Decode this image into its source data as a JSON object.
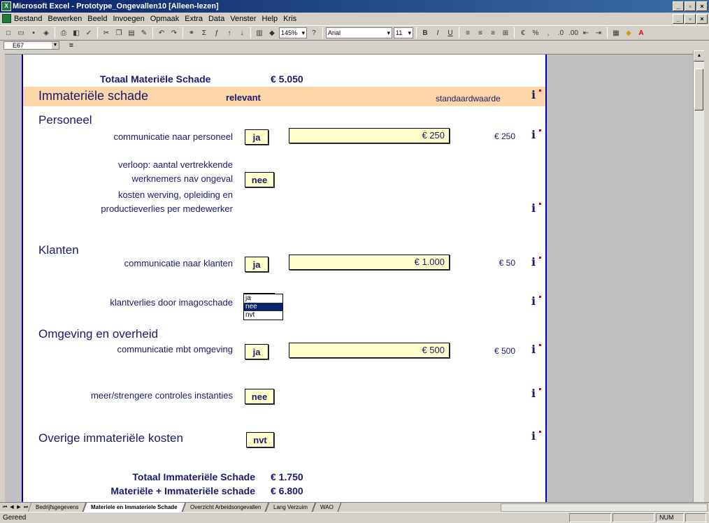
{
  "window": {
    "title": "Microsoft Excel - Prototype_Ongevallen10  [Alleen-lezen]"
  },
  "menu": [
    "Bestand",
    "Bewerken",
    "Beeld",
    "Invoegen",
    "Opmaak",
    "Extra",
    "Data",
    "Venster",
    "Help",
    "Kris"
  ],
  "toolbar": {
    "zoom": "145%",
    "font": "Arial",
    "size": "11"
  },
  "formula": {
    "cell": "E67",
    "eq": "="
  },
  "sheet": {
    "total_materieel_label": "Totaal Materiële Schade",
    "total_materieel_value": "€ 5.050",
    "banner_title": "Immateriële schade",
    "banner_relevant": "relevant",
    "banner_standard": "standaardwaarde",
    "sec_personeel": "Personeel",
    "row1_label": "communicatie naar personeel",
    "row1_sel": "ja",
    "row1_amount": "€ 250",
    "row1_std": "€ 250",
    "row2_label_a": "verloop: aantal vertrekkende",
    "row2_label_b": "werknemers nav ongeval",
    "row2_sel": "nee",
    "row2_label_c": "kosten werving, opleiding en",
    "row2_label_d": "productieverlies per medewerker",
    "sec_klanten": "Klanten",
    "row3_label": "communicatie naar klanten",
    "row3_sel": "ja",
    "row3_amount": "€ 1.000",
    "row3_std": "€ 50",
    "row4_label": "klantverlies door imagoschade",
    "dropdown": [
      "ja",
      "nee",
      "nvt"
    ],
    "sec_omgeving": "Omgeving en overheid",
    "row5_label": "communicatie mbt omgeving",
    "row5_sel": "ja",
    "row5_amount": "€ 500",
    "row5_std": "€ 500",
    "row6_label": "meer/strengere controles instanties",
    "row6_sel": "nee",
    "sec_overig": "Overige immateriële kosten",
    "row7_sel": "nvt",
    "total_immat_label": "Totaal Immateriële Schade",
    "total_immat_value": "€ 1.750",
    "total_all_label": "Materiële + Immateriële schade",
    "total_all_value": "€ 6.800"
  },
  "tabs": [
    "Bedrijfsgegevens",
    "Materiele en Immateriele Schade",
    "Overzicht Arbeidsongevallen",
    "Lang Verzuim",
    "WAO"
  ],
  "status": {
    "text": "Gereed",
    "num": "NUM"
  }
}
